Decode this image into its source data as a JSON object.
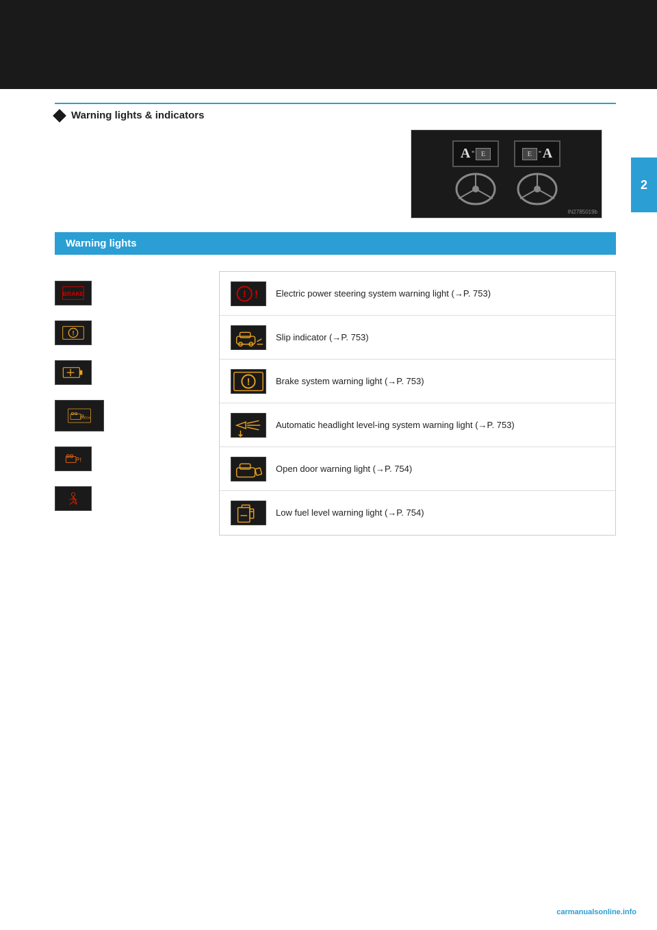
{
  "page": {
    "topBarColor": "#1a1a1a",
    "tabNumber": "2",
    "accentColor": "#2b9ed4"
  },
  "section": {
    "diamondColor": "#1a1a1a",
    "title": "Warning lights & indicators"
  },
  "illustration": {
    "watermark": "IN2785019b",
    "leftLabel": "A“E",
    "rightLabel": "E”A"
  },
  "warningLights": {
    "sectionTitle": "Warning lights",
    "leftIcons": [
      {
        "id": "brake",
        "label": "BRAKE",
        "type": "red-text"
      },
      {
        "id": "seatbelt",
        "label": "ⓘ",
        "type": "yellow-circle"
      },
      {
        "id": "battery",
        "label": "□—",
        "type": "yellow-battery"
      },
      {
        "id": "check-engine",
        "label": "CHECK",
        "type": "yellow-check"
      },
      {
        "id": "engine-malfunction",
        "label": "⚠",
        "type": "orange-engine"
      },
      {
        "id": "person-seatbelt",
        "label": "⚠",
        "type": "red-person"
      }
    ],
    "rightDescriptions": [
      {
        "id": "eps-warning",
        "iconSymbol": "⚠!",
        "iconType": "red-icon",
        "text": "Electric  power  steering system warning light (→P. 753)"
      },
      {
        "id": "slip-indicator",
        "iconSymbol": "⚠",
        "iconType": "yellow-slip",
        "text": "Slip indicator (→P. 753)"
      },
      {
        "id": "brake-system",
        "iconSymbol": "ⓘ",
        "iconType": "yellow-brake",
        "text": "Brake system warning light (→P. 753)"
      },
      {
        "id": "auto-headlight",
        "iconSymbol": "⛅",
        "iconType": "yellow-headlight",
        "text": "Automatic headlight level-ing system warning light (→P. 753)"
      },
      {
        "id": "open-door",
        "iconSymbol": "⚠",
        "iconType": "yellow-door",
        "text": "Open door warning light (→P. 754)"
      },
      {
        "id": "low-fuel",
        "iconSymbol": "⛽",
        "iconType": "yellow-fuel",
        "text": "Low fuel level warning light (→P. 754)"
      }
    ]
  },
  "footer": {
    "website": "carmanualsonline.info"
  }
}
